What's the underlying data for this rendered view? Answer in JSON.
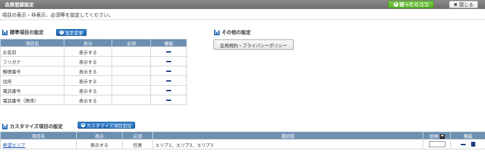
{
  "header": {
    "title": "会員登録設定",
    "help_label": "困ったらココ",
    "close_label": "閉じる"
  },
  "description": "項目の表示・非表示、必須等を設定してください。",
  "standard": {
    "title": "標準項目の設定",
    "button_label": "設定変更",
    "columns": [
      "項目名",
      "表示",
      "必須",
      "機能"
    ],
    "rows": [
      {
        "name": "お名前",
        "display": "表示する",
        "required": ""
      },
      {
        "name": "フリガナ",
        "display": "表示する",
        "required": ""
      },
      {
        "name": "郵便番号",
        "display": "表示する",
        "required": ""
      },
      {
        "name": "住所",
        "display": "表示する",
        "required": ""
      },
      {
        "name": "電話番号",
        "display": "表示する",
        "required": ""
      },
      {
        "name": "電話番号（携帯）",
        "display": "表示する",
        "required": ""
      }
    ]
  },
  "other": {
    "title": "その他の設定",
    "button_label": "会員規約・プライバシーポリシー"
  },
  "custom": {
    "title": "カスタマイズ項目の設定",
    "button_label": "カスタマイズ項目追加",
    "columns": [
      "項目名",
      "表示",
      "必須",
      "選択肢",
      "並順",
      "機能"
    ],
    "rows": [
      {
        "name": "希望エリア",
        "display": "表示する",
        "required": "任意",
        "choices": "エリア1、エリア2、エリア3"
      }
    ]
  },
  "colors": {
    "header_bg": "#6c6c6c",
    "help_green": "#56ad2a",
    "accent_blue": "#1e66b0",
    "table_header": "#6d8fb0"
  }
}
